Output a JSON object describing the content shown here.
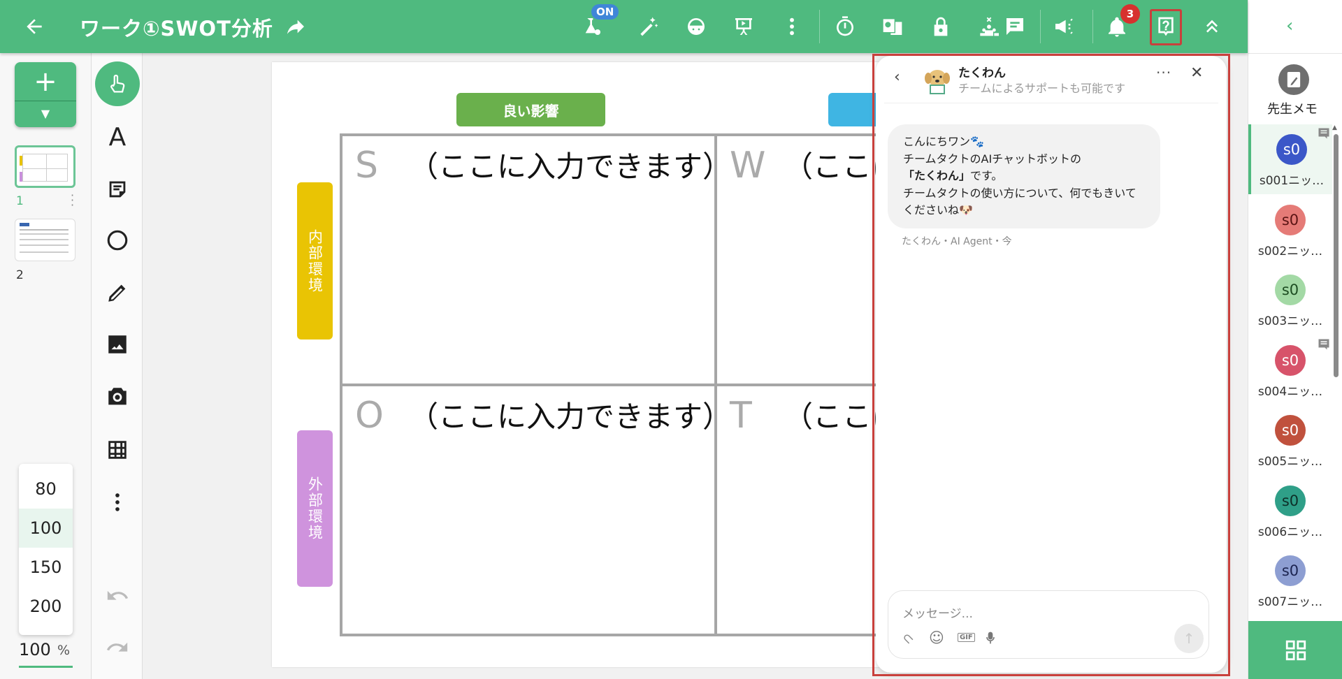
{
  "header": {
    "title": "ワーク①SWOT分析",
    "on_badge": "ON",
    "notification_count": "3",
    "icons": [
      "back-arrow",
      "share",
      "ai-settings",
      "magic-wand",
      "student-view",
      "presentation",
      "more",
      "timer",
      "compare",
      "lock",
      "hide-participants-chat",
      "announce",
      "bell",
      "help",
      "collapse"
    ]
  },
  "pages": {
    "items": [
      {
        "number": "1"
      },
      {
        "number": "2"
      }
    ]
  },
  "zoom": {
    "options": [
      "80",
      "100",
      "150",
      "200"
    ],
    "selected": "100",
    "value": "100",
    "unit": "%"
  },
  "board": {
    "col_headers": [
      "良い影響",
      ""
    ],
    "row_labels": [
      "内部環境",
      "外部環境"
    ],
    "cells": [
      {
        "letter": "S",
        "text": "（ここに入力できます）"
      },
      {
        "letter": "W",
        "text": "（ここに入力できます）"
      },
      {
        "letter": "O",
        "text": "（ここに入力できます）"
      },
      {
        "letter": "T",
        "text": "（ここに入力できます）"
      }
    ]
  },
  "chat": {
    "bot_name": "たくわん",
    "subtitle": "チームによるサポートも可能です",
    "message": {
      "line1": "こんにちワン🐾",
      "line2a": "チームタクトのAIチャットボットの",
      "line2b": "「たくわん」",
      "line2c": "です。",
      "line3": "チームタクトの使い方について、何でもきいてくださいね🐶"
    },
    "meta": "たくわん・AI Agent・今",
    "input_placeholder": "メッセージ...",
    "gif_label": "GIF"
  },
  "right_sidebar": {
    "teacher_memo": "先生メモ",
    "students": [
      {
        "initials": "s0",
        "name": "s001ニッ…",
        "color": "#3b57c8",
        "text": "#ffffff",
        "selected": true,
        "comment": true
      },
      {
        "initials": "s0",
        "name": "s002ニッ…",
        "color": "#e57b77",
        "text": "#5a1414",
        "selected": false,
        "comment": false
      },
      {
        "initials": "s0",
        "name": "s003ニッ…",
        "color": "#a3d9a5",
        "text": "#1d4d22",
        "selected": false,
        "comment": false
      },
      {
        "initials": "s0",
        "name": "s004ニッ…",
        "color": "#d7536a",
        "text": "#ffffff",
        "selected": false,
        "comment": true
      },
      {
        "initials": "s0",
        "name": "s005ニッ…",
        "color": "#c0513d",
        "text": "#ffffff",
        "selected": false,
        "comment": false
      },
      {
        "initials": "s0",
        "name": "s006ニッ…",
        "color": "#2f9f88",
        "text": "#0d2f28",
        "selected": false,
        "comment": false
      },
      {
        "initials": "s0",
        "name": "s007ニッ…",
        "color": "#8d9ed2",
        "text": "#1c2450",
        "selected": false,
        "comment": false
      }
    ]
  }
}
